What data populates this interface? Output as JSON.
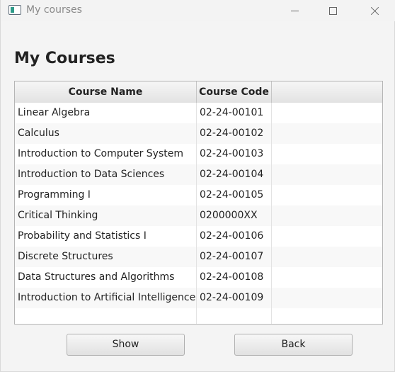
{
  "window": {
    "title": "My courses"
  },
  "page": {
    "heading": "My Courses"
  },
  "table": {
    "columns": [
      "Course Name",
      "Course Code",
      ""
    ],
    "rows": [
      {
        "name": "Linear Algebra",
        "code": "02-24-00101"
      },
      {
        "name": "Calculus",
        "code": "02-24-00102"
      },
      {
        "name": "Introduction to Computer System",
        "code": "02-24-00103"
      },
      {
        "name": "Introduction to Data Sciences",
        "code": "02-24-00104"
      },
      {
        "name": "Programming I",
        "code": "02-24-00105"
      },
      {
        "name": "Critical Thinking",
        "code": "0200000XX"
      },
      {
        "name": "Probability and Statistics I",
        "code": "02-24-00106"
      },
      {
        "name": "Discrete Structures",
        "code": "02-24-00107"
      },
      {
        "name": "Data Structures and Algorithms",
        "code": "02-24-00108"
      },
      {
        "name": "Introduction to Artificial Intelligence",
        "code": "02-24-00109"
      },
      {
        "name": "",
        "code": ""
      }
    ]
  },
  "buttons": {
    "show": "Show",
    "back": "Back"
  }
}
